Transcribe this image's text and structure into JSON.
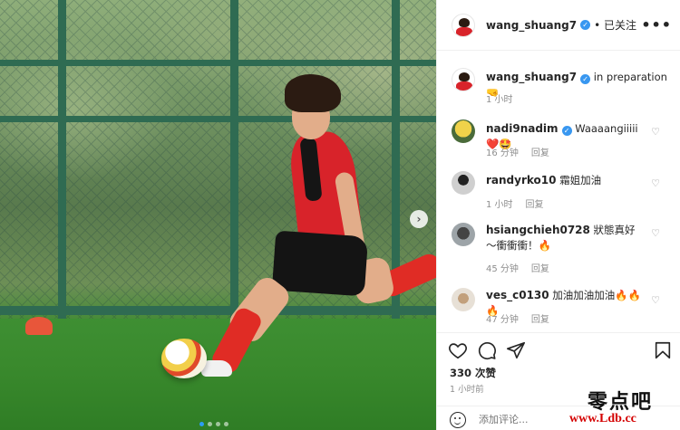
{
  "header": {
    "username": "wang_shuang7",
    "follow_status": "已关注",
    "more": "•••"
  },
  "caption": {
    "username": "wang_shuang7",
    "text": "in preparation 🤜",
    "time": "1 小时"
  },
  "comments": [
    {
      "username": "nadi9nadim",
      "verified": true,
      "text": "Waaaangiiiii❤️🤩",
      "time": "16 分钟",
      "reply": "回复"
    },
    {
      "username": "randyrko10",
      "verified": false,
      "text": "霜姐加油",
      "time": "1 小时",
      "reply": "回复"
    },
    {
      "username": "hsiangchieh0728",
      "verified": false,
      "text": "狀態真好～衝衝衝！🔥",
      "time": "45 分钟",
      "reply": "回复"
    },
    {
      "username": "ves_c0130",
      "verified": false,
      "text": "加油加油加油🔥🔥🔥",
      "time": "47 分钟",
      "reply": "回复"
    }
  ],
  "actions": {
    "likes": "330 次赞",
    "post_time": "1 小时前"
  },
  "add_comment": {
    "placeholder": "添加评论..."
  },
  "carousel": {
    "next": "›",
    "slide_count": 4,
    "active_slide": 1
  },
  "watermark": {
    "cn": "零点吧",
    "url": "www.Ldb.cc"
  },
  "icons": {
    "like": "heart-icon",
    "comment": "comment-icon",
    "share": "send-icon",
    "save": "bookmark-icon",
    "emoji": "emoji-icon",
    "verified": "verified-icon"
  }
}
